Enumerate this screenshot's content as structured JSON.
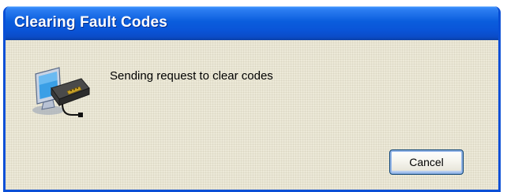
{
  "dialog": {
    "title": "Clearing Fault Codes",
    "message": "Sending request to clear codes",
    "icon": "computer-diagnostic-device-icon",
    "cancel_label": "Cancel"
  },
  "colors": {
    "titlebar_blue": "#0a5ddd",
    "dialog_face": "#ece9d8",
    "window_border": "#0a4fd6"
  }
}
